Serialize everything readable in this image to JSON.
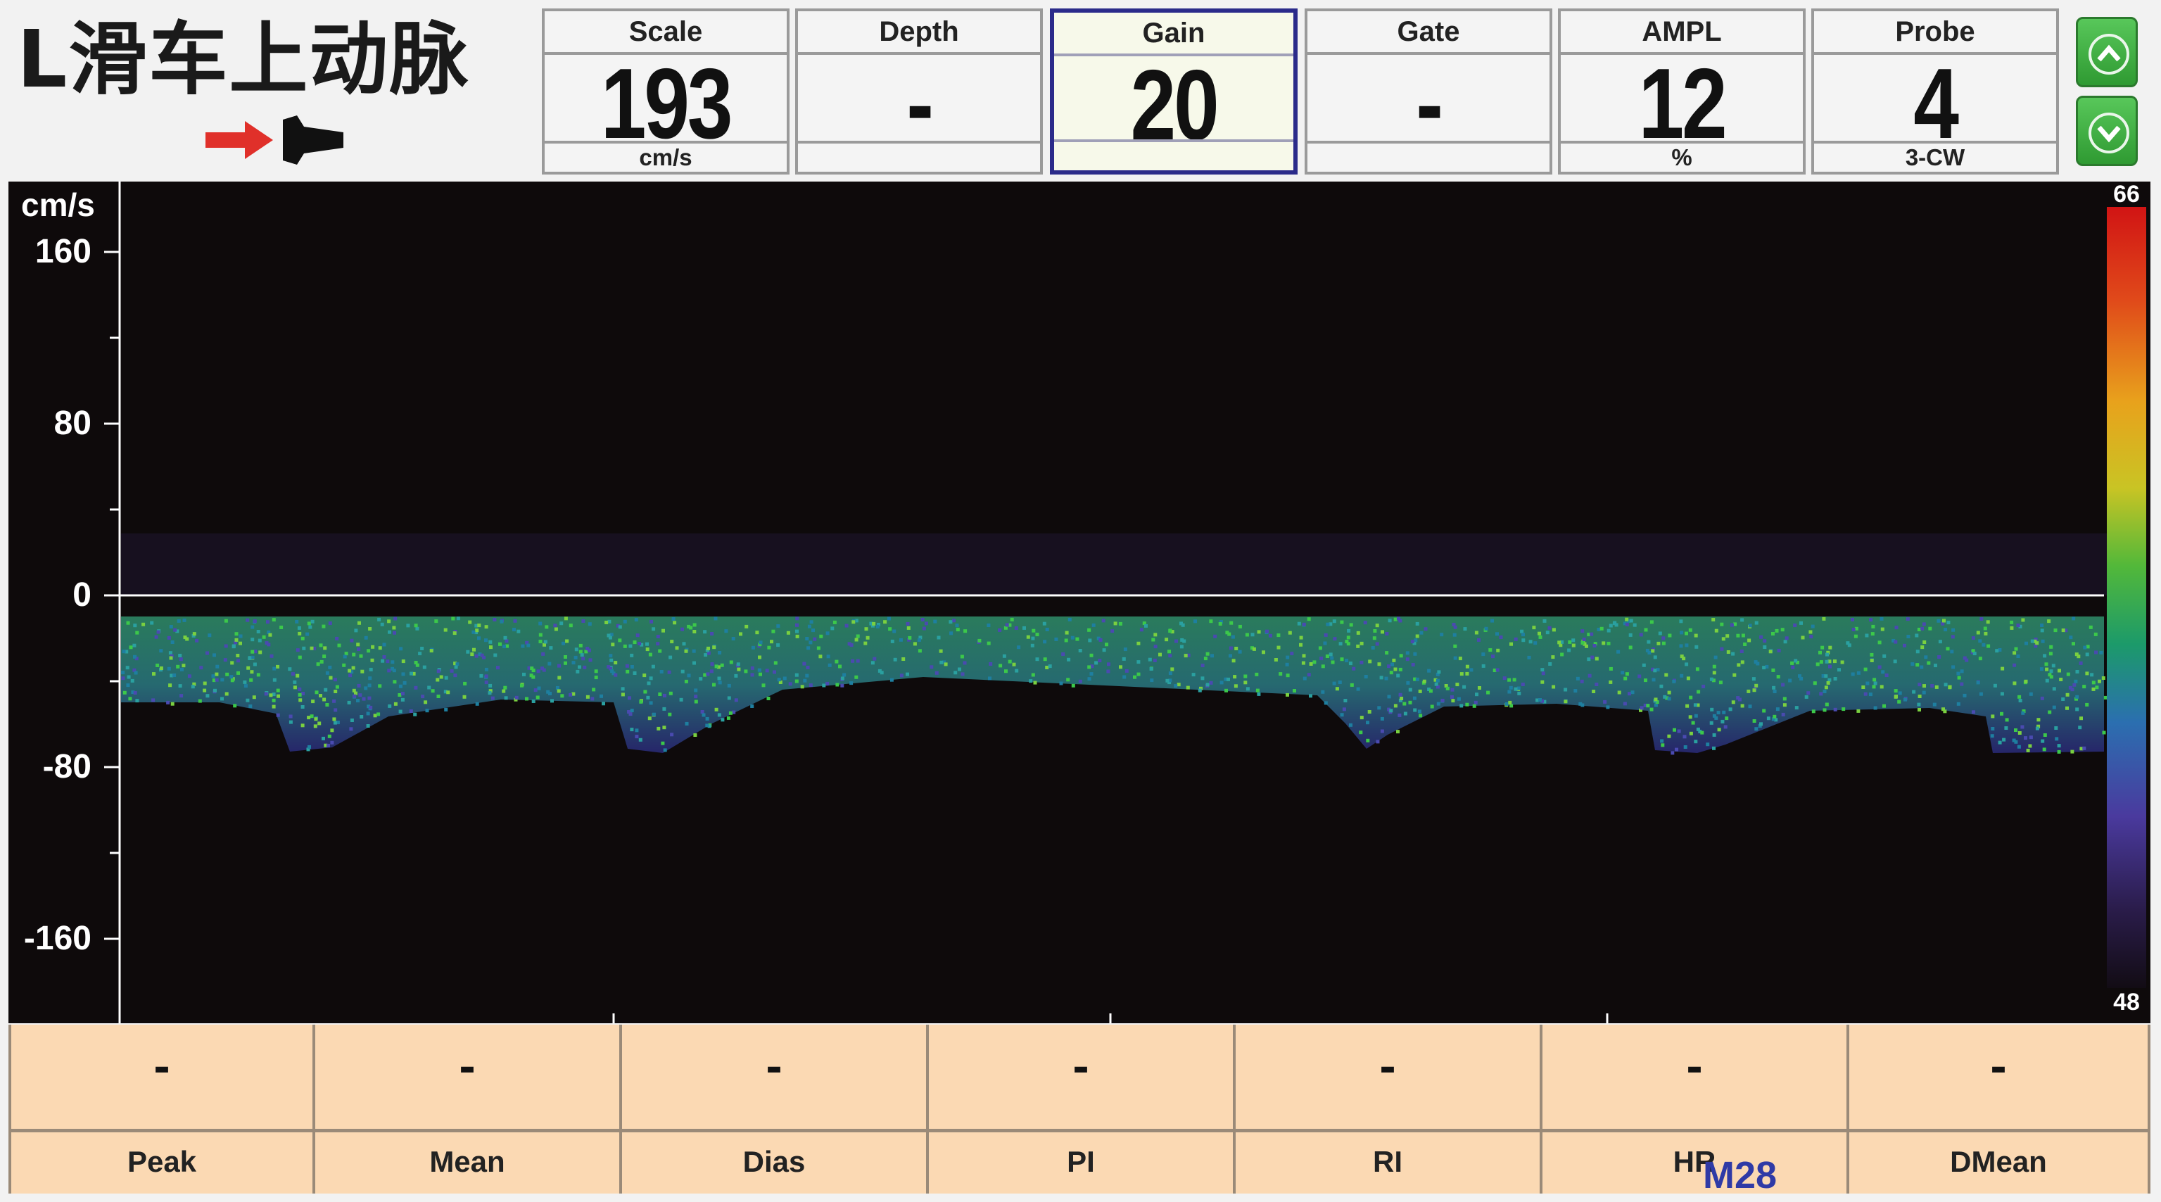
{
  "header": {
    "title": "L滑车上动脉",
    "probe_indicator_icon": "probe-direction-icon"
  },
  "params": [
    {
      "label": "Scale",
      "value": "193",
      "unit": "cm/s",
      "selected": false
    },
    {
      "label": "Depth",
      "value": "-",
      "unit": "",
      "selected": false
    },
    {
      "label": "Gain",
      "value": "20",
      "unit": "",
      "selected": true
    },
    {
      "label": "Gate",
      "value": "-",
      "unit": "",
      "selected": false
    },
    {
      "label": "AMPL",
      "value": "12",
      "unit": "%",
      "selected": false
    },
    {
      "label": "Probe",
      "value": "4",
      "unit": "3-CW",
      "selected": false
    }
  ],
  "scroll_buttons": {
    "up_icon": "chevron-up-icon",
    "down_icon": "chevron-down-icon"
  },
  "spectrum": {
    "y_unit": "cm/s",
    "y_ticks": [
      "160",
      "80",
      "0",
      "-80",
      "-160"
    ],
    "colorbar_max": "66",
    "colorbar_min": "48",
    "colors": {
      "background": "#0e0a0b",
      "baseline": "#ffffff"
    }
  },
  "measurements": [
    {
      "label": "Peak",
      "value": "-"
    },
    {
      "label": "Mean",
      "value": "-"
    },
    {
      "label": "Dias",
      "value": "-"
    },
    {
      "label": "PI",
      "value": "-"
    },
    {
      "label": "RI",
      "value": "-"
    },
    {
      "label": "HR",
      "value": "-"
    },
    {
      "label": "DMean",
      "value": "-"
    }
  ],
  "figure_id": "M28"
}
